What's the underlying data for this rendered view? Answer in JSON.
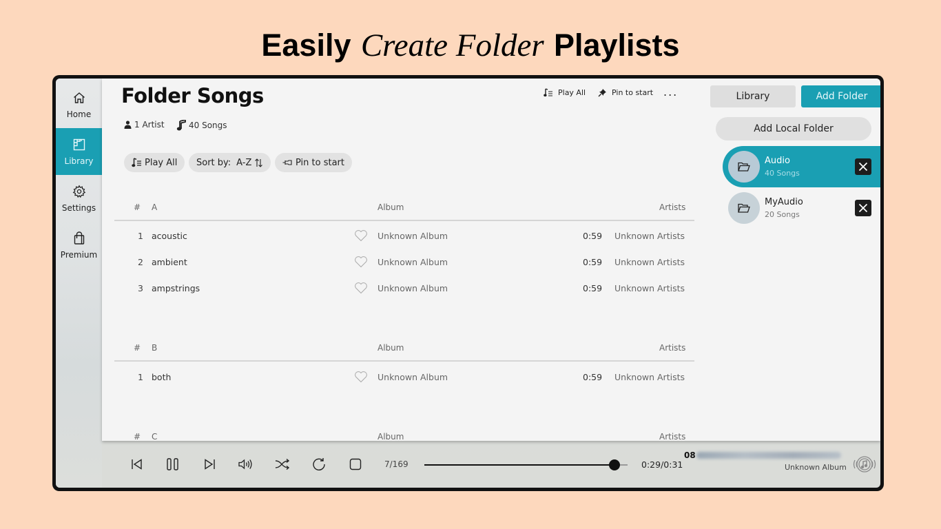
{
  "banner": {
    "part1": "Easily",
    "part2": "Create Folder",
    "part3": "Playlists"
  },
  "sidebar": {
    "items": [
      {
        "label": "Home",
        "icon": "home-icon",
        "active": false
      },
      {
        "label": "Library",
        "icon": "library-icon",
        "active": true
      },
      {
        "label": "Settings",
        "icon": "gear-icon",
        "active": false
      },
      {
        "label": "Premium",
        "icon": "shopping-bag-icon",
        "active": false
      }
    ]
  },
  "header": {
    "title": "Folder Songs",
    "artist_count": "1 Artist",
    "song_count": "40 Songs",
    "top_actions": {
      "play_all": "Play All",
      "pin_to_start": "Pin to start",
      "more": "..."
    }
  },
  "toolbar": {
    "play_all": "Play All",
    "sort_label": "Sort by:",
    "sort_value": "A-Z",
    "pin_to_start": "Pin to start"
  },
  "groups": [
    {
      "letter": "A",
      "hash": "#",
      "album_header": "Album",
      "artists_header": "Artists",
      "rows": [
        {
          "num": "1",
          "title": "acoustic",
          "album": "Unknown Album",
          "duration": "0:59",
          "artist": "Unknown Artists"
        },
        {
          "num": "2",
          "title": "ambient",
          "album": "Unknown Album",
          "duration": "0:59",
          "artist": "Unknown Artists"
        },
        {
          "num": "3",
          "title": "ampstrings",
          "album": "Unknown Album",
          "duration": "0:59",
          "artist": "Unknown Artists"
        }
      ]
    },
    {
      "letter": "B",
      "hash": "#",
      "album_header": "Album",
      "artists_header": "Artists",
      "rows": [
        {
          "num": "1",
          "title": "both",
          "album": "Unknown Album",
          "duration": "0:59",
          "artist": "Unknown Artists"
        }
      ]
    },
    {
      "letter": "C",
      "hash": "#",
      "album_header": "Album",
      "artists_header": "Artists",
      "rows": []
    }
  ],
  "right_panel": {
    "tabs": [
      {
        "label": "Library",
        "active": false
      },
      {
        "label": "Add Folder",
        "active": true
      }
    ],
    "add_local_folder": "Add Local Folder",
    "folders": [
      {
        "name": "Audio",
        "count": "40 Songs",
        "active": true
      },
      {
        "name": "MyAudio",
        "count": "20 Songs",
        "active": false
      }
    ]
  },
  "player": {
    "track_position": "7/169",
    "progress_fraction": 0.935,
    "time": "0:29/0:31",
    "now_playing_number": "08",
    "now_playing_album": "Unknown Album"
  },
  "colors": {
    "accent": "#1a9fb3",
    "background": "#fdd8bd",
    "panel": "#f4f4f4"
  }
}
